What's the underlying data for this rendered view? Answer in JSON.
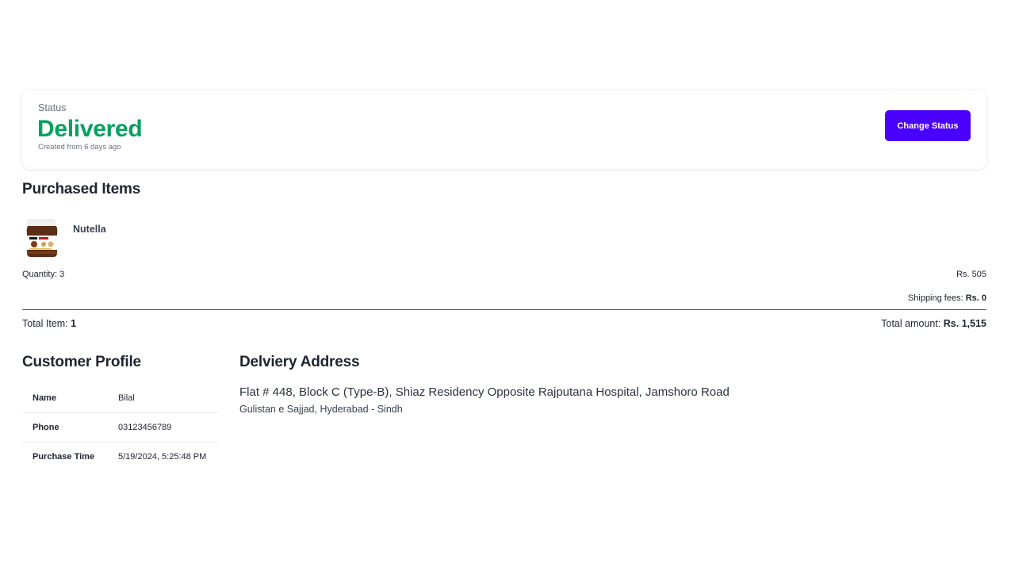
{
  "status": {
    "label": "Status",
    "value": "Delivered",
    "created": "Created from 6 days ago",
    "change_button": "Change Status"
  },
  "purchased": {
    "title": "Purchased Items",
    "item": {
      "name": "Nutella",
      "quantity_label": "Quantity: 3",
      "price": "Rs. 505"
    },
    "shipping_label": "Shipping fees:",
    "shipping_value": "Rs. 0",
    "total_items_label": "Total Item:",
    "total_items_value": "1",
    "total_amount_label": "Total amount:",
    "total_amount_value": "Rs. 1,515"
  },
  "customer": {
    "title": "Customer Profile",
    "rows": [
      {
        "key": "Name",
        "value": "Bilal"
      },
      {
        "key": "Phone",
        "value": "03123456789"
      },
      {
        "key": "Purchase Time",
        "value": "5/19/2024, 5:25:48 PM"
      }
    ]
  },
  "delivery": {
    "title": "Delviery Address",
    "line1": "Flat # 448, Block C (Type-B), Shiaz Residency Opposite Rajputana Hospital, Jamshoro Road",
    "line2": "Gulistan e Sajjad, Hyderabad - Sindh"
  },
  "colors": {
    "status_delivered": "#07a05f",
    "accent_button": "#4a00ff"
  }
}
